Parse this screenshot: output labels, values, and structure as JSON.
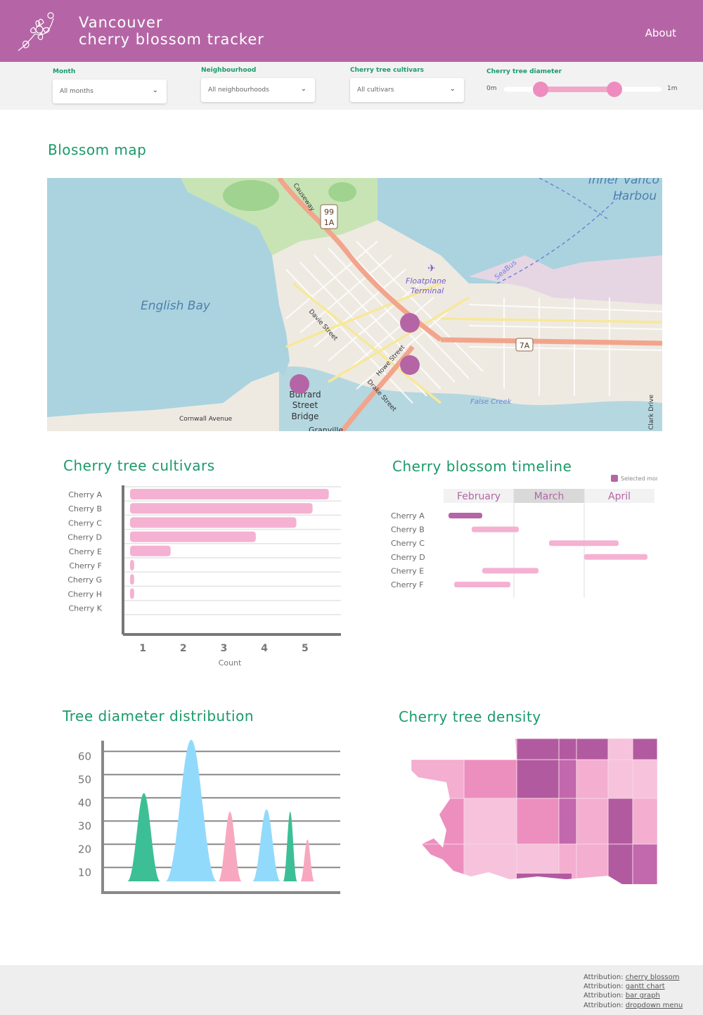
{
  "header": {
    "title_line1": "Vancouver",
    "title_line2": "cherry blossom tracker",
    "about": "About"
  },
  "filters": {
    "month": {
      "label": "Month",
      "value": "All months"
    },
    "neighbourhood": {
      "label": "Neighbourhood",
      "value": "All neighbourhoods"
    },
    "cultivar": {
      "label": "Cherry tree cultivars",
      "value": "All cultivars"
    },
    "diameter": {
      "label": "Cherry tree diameter",
      "min_label": "0m",
      "max_label": "1m",
      "range": [
        0.2,
        0.7
      ]
    }
  },
  "map": {
    "title": "Blossom map",
    "labels": {
      "english_bay": "English Bay",
      "floatplane": "Floatplane",
      "terminal": "Terminal",
      "seabus": "SeaBus",
      "davie": "Davie Street",
      "howe": "Howe Street",
      "drake": "Drake Street",
      "burrard1": "Burrard",
      "burrard2": "Street",
      "burrard3": "Bridge",
      "cornwall": "Cornwall Avenue",
      "false_creek": "False Creek",
      "clark": "Clark Drive",
      "causeway": "Causeway",
      "harbour1": "Inner Vanco",
      "harbour2": "Harbou",
      "hwy99": "99",
      "hwy1a": "1A",
      "hwy7a": "7A",
      "granville": "Granville"
    }
  },
  "chart_data": [
    {
      "type": "bar",
      "title": "Cherry tree cultivars",
      "categories": [
        "Cherry A",
        "Cherry B",
        "Cherry C",
        "Cherry D",
        "Cherry E",
        "Cherry F",
        "Cherry G",
        "Cherry H",
        "Cherry K"
      ],
      "values": [
        5.5,
        5.1,
        4.7,
        3.7,
        1.6,
        0.7,
        0.7,
        0.7,
        0.4
      ],
      "xticks": [
        "1",
        "2",
        "3",
        "4",
        "5"
      ],
      "xlabel": "Count",
      "xlim": [
        0.6,
        5.8
      ],
      "color": "#f4b1d2"
    },
    {
      "type": "gantt",
      "title": "Cherry blossom timeline",
      "legend": "Selected mor",
      "months": [
        "February",
        "March",
        "April"
      ],
      "rows": [
        {
          "label": "Cherry A",
          "start": 0.07,
          "end": 0.55,
          "selected": true
        },
        {
          "label": "Cherry B",
          "start": 0.4,
          "end": 1.07,
          "selected": false
        },
        {
          "label": "Cherry C",
          "start": 1.5,
          "end": 2.49,
          "selected": false
        },
        {
          "label": "Cherry D",
          "start": 2.0,
          "end": 2.9,
          "selected": false
        },
        {
          "label": "Cherry E",
          "start": 0.55,
          "end": 1.35,
          "selected": false
        },
        {
          "label": "Cherry F",
          "start": 0.15,
          "end": 0.95,
          "selected": false
        }
      ],
      "colors": {
        "selected": "#b565a5",
        "default": "#f4b1d2",
        "header": "#f2f2f2",
        "header_active": "#d9d9d9"
      }
    },
    {
      "type": "area",
      "title": "Tree diameter distribution",
      "yticks": [
        "60",
        "50",
        "40",
        "30",
        "20",
        "10"
      ],
      "ylim": [
        5,
        65
      ],
      "peaks": [
        {
          "center": 0.12,
          "height": 43,
          "width": 0.07,
          "color": "#3dbf95"
        },
        {
          "center": 0.34,
          "height": 66,
          "width": 0.11,
          "color": "#92dafc"
        },
        {
          "center": 0.52,
          "height": 35,
          "width": 0.05,
          "color": "#f7a8bf"
        },
        {
          "center": 0.69,
          "height": 36,
          "width": 0.06,
          "color": "#92dafc"
        },
        {
          "center": 0.8,
          "height": 35,
          "width": 0.03,
          "color": "#3dbf95"
        },
        {
          "center": 0.88,
          "height": 23,
          "width": 0.03,
          "color": "#f7a8bf"
        }
      ]
    },
    {
      "type": "heatmap",
      "title": "Cherry tree density",
      "colors": [
        "#f6c2dc",
        "#f3aed0",
        "#ec8fbe",
        "#c268ad",
        "#b25aa0"
      ]
    }
  ],
  "footer": {
    "prefix": "Attribution:",
    "links": [
      "cherry blossom",
      " gantt chart",
      "bar graph",
      "dropdown menu"
    ]
  }
}
